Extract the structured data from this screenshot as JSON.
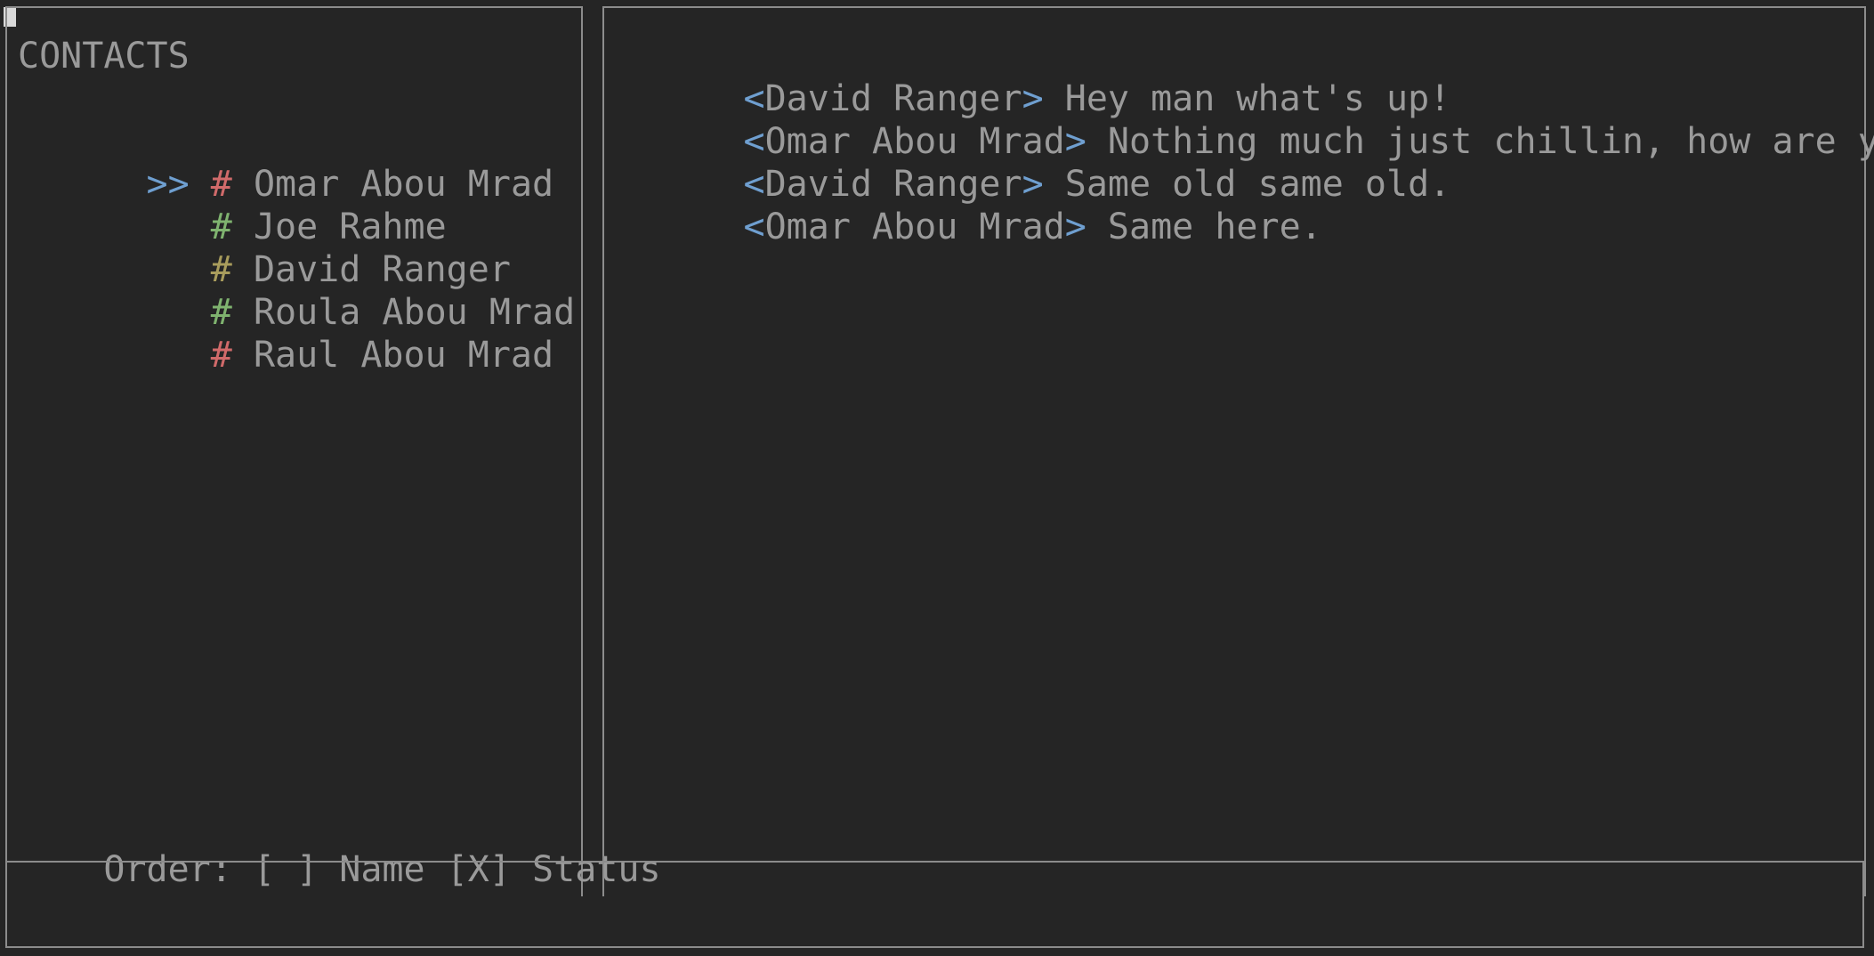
{
  "contacts": {
    "title": "CONTACTS",
    "selected_marker": ">>",
    "items": [
      {
        "hash": "#",
        "name": "Omar Abou Mrad",
        "status_color": "#d06a6a",
        "selected": true
      },
      {
        "hash": "#",
        "name": "Joe Rahme",
        "status_color": "#7fb36f",
        "selected": false
      },
      {
        "hash": "#",
        "name": "David Ranger",
        "status_color": "#a89c5c",
        "selected": false
      },
      {
        "hash": "#",
        "name": "Roula Abou Mrad",
        "status_color": "#7fb36f",
        "selected": false
      },
      {
        "hash": "#",
        "name": "Raul Abou Mrad",
        "status_color": "#d06a6a",
        "selected": false
      }
    ],
    "order_label": "Order:",
    "order_name_box": "[ ]",
    "order_name_label": "Name",
    "order_status_box": "[X]",
    "order_status_label": "Status"
  },
  "chat": {
    "messages": [
      {
        "open": "<",
        "sender": "David Ranger",
        "close": ">",
        "text": " Hey man what's up!"
      },
      {
        "open": "<",
        "sender": "Omar Abou Mrad",
        "close": ">",
        "text": " Nothing much just chillin, how are you?"
      },
      {
        "open": "<",
        "sender": "David Ranger",
        "close": ">",
        "text": " Same old same old."
      },
      {
        "open": "<",
        "sender": "Omar Abou Mrad",
        "close": ">",
        "text": " Same here."
      }
    ]
  },
  "input": {
    "value": ""
  },
  "colors": {
    "background": "#252525",
    "border": "#8c8c8c",
    "text": "#9a9a9a",
    "accent_blue": "#6f9fd0",
    "status_red": "#d06a6a",
    "status_green": "#7fb36f",
    "status_yellow": "#a89c5c"
  }
}
